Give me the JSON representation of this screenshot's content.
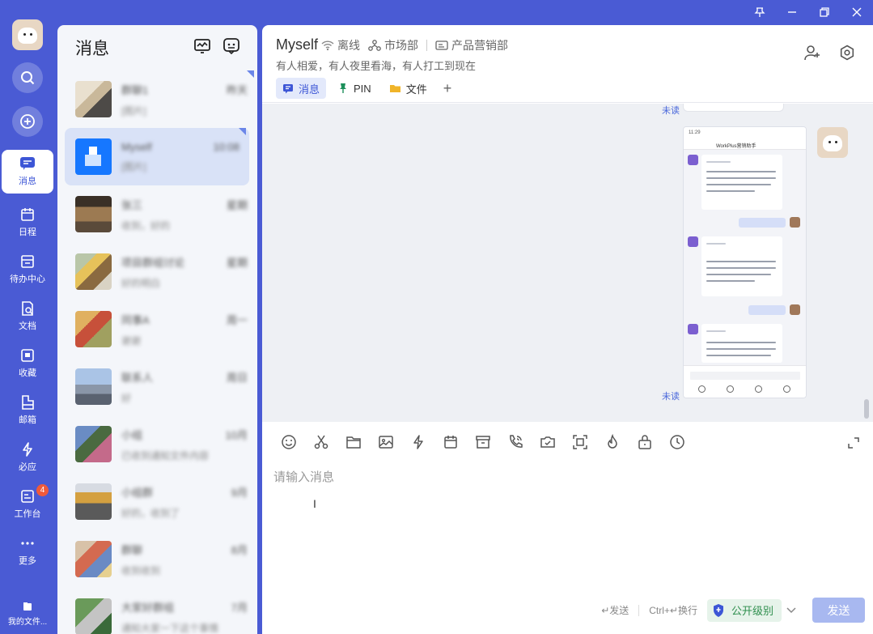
{
  "window": {
    "pin_icon": "pin-icon",
    "min_icon": "minimize-icon",
    "max_icon": "restore-icon",
    "close_icon": "close-icon"
  },
  "rail": {
    "items": [
      {
        "label": "消息",
        "icon": "message-icon",
        "active": true
      },
      {
        "label": "日程",
        "icon": "calendar-icon"
      },
      {
        "label": "待办中心",
        "icon": "todo-icon"
      },
      {
        "label": "文档",
        "icon": "document-icon"
      },
      {
        "label": "收藏",
        "icon": "favorite-icon"
      },
      {
        "label": "邮箱",
        "icon": "mail-icon"
      },
      {
        "label": "必应",
        "icon": "lightning-icon"
      },
      {
        "label": "工作台",
        "icon": "workbench-icon",
        "badge": "4"
      },
      {
        "label": "更多",
        "icon": "more-icon"
      }
    ],
    "my_files": "我的文件..."
  },
  "list": {
    "title": "消息",
    "conversations": [
      {
        "name": "群聊1",
        "time": "昨天",
        "preview": "[图片]"
      },
      {
        "name": "Myself",
        "time": "10:08",
        "preview": "[图片]"
      },
      {
        "name": "张三",
        "time": "星期",
        "preview": "收到，好的"
      },
      {
        "name": "项目群组讨论",
        "time": "星期",
        "preview": "好的明白"
      },
      {
        "name": "同事A",
        "time": "周一",
        "preview": "谢谢"
      },
      {
        "name": "联系人",
        "time": "周日",
        "preview": "好"
      },
      {
        "name": "小组",
        "time": "10月",
        "preview": "已收到通知文件内容"
      },
      {
        "name": "小组群",
        "time": "9月",
        "preview": "好的，收到了"
      },
      {
        "name": "群聊",
        "time": "8月",
        "preview": "收到收到"
      },
      {
        "name": "大家好群组",
        "time": "7月",
        "preview": "通知大家一下这个事情"
      }
    ]
  },
  "chat": {
    "name": "Myself",
    "status": "离线",
    "dept": "市场部",
    "org": "产品营销部",
    "signature": "有人相爱，有人夜里看海，有人打工到现在",
    "tabs": [
      {
        "label": "消息",
        "icon": "chat-bubble-icon",
        "active": true
      },
      {
        "label": "PIN",
        "icon": "pin-tab-icon"
      },
      {
        "label": "文件",
        "icon": "folder-icon"
      }
    ],
    "tab_add": "+",
    "unread_label": "未读",
    "shot_title": "WorkPlus营销助手",
    "composer_placeholder": "请输入消息",
    "hint_send": "↵发送",
    "hint_newline": "Ctrl+↵换行",
    "level_label": "公开级别",
    "send_label": "发送"
  }
}
